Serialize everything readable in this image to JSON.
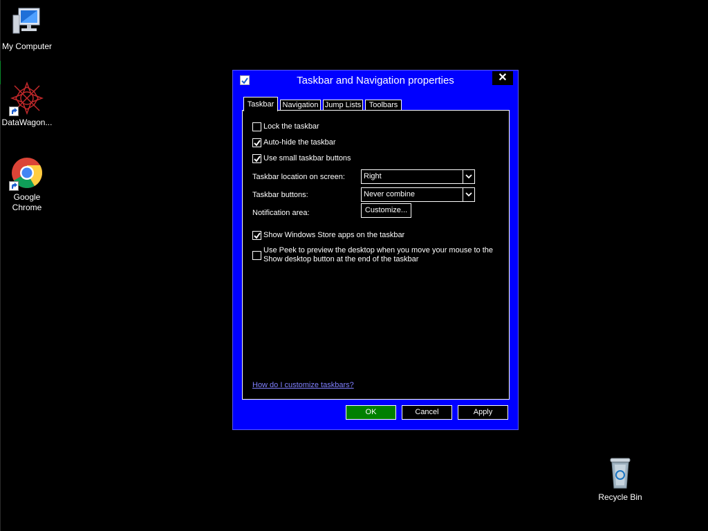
{
  "desktop": {
    "icons": [
      {
        "label": "My Computer"
      },
      {
        "label": "DataWagon..."
      },
      {
        "label": "Google Chrome"
      },
      {
        "label": "Recycle Bin"
      }
    ]
  },
  "dialog": {
    "title": "Taskbar and Navigation properties",
    "close_glyph": "✕",
    "tabs": [
      {
        "label": "Taskbar",
        "active": true
      },
      {
        "label": "Navigation"
      },
      {
        "label": "Jump Lists"
      },
      {
        "label": "Toolbars"
      }
    ],
    "options": {
      "lock_taskbar": {
        "label": "Lock the taskbar",
        "checked": false
      },
      "auto_hide": {
        "label": "Auto-hide the taskbar",
        "checked": true
      },
      "small_buttons": {
        "label": "Use small taskbar buttons",
        "checked": true
      },
      "store_apps": {
        "label": "Show Windows Store apps on the taskbar",
        "checked": true
      },
      "peek_line1": "Use Peek to preview the desktop when you move your mouse to the",
      "peek_line2": "Show desktop button at the end of the taskbar",
      "peek_checked": false
    },
    "location": {
      "label": "Taskbar location on screen:",
      "value": "Right"
    },
    "buttons_combine": {
      "label": "Taskbar buttons:",
      "value": "Never combine"
    },
    "notification": {
      "label": "Notification area:",
      "button": "Customize..."
    },
    "help_link": "How do I customize taskbars?",
    "footer": {
      "ok": "OK",
      "cancel": "Cancel",
      "apply": "Apply"
    }
  },
  "colors": {
    "desktop_bg": "#000000",
    "dialog_frame": "#0000ff",
    "ok_button": "#008000",
    "link": "#8080ff"
  }
}
